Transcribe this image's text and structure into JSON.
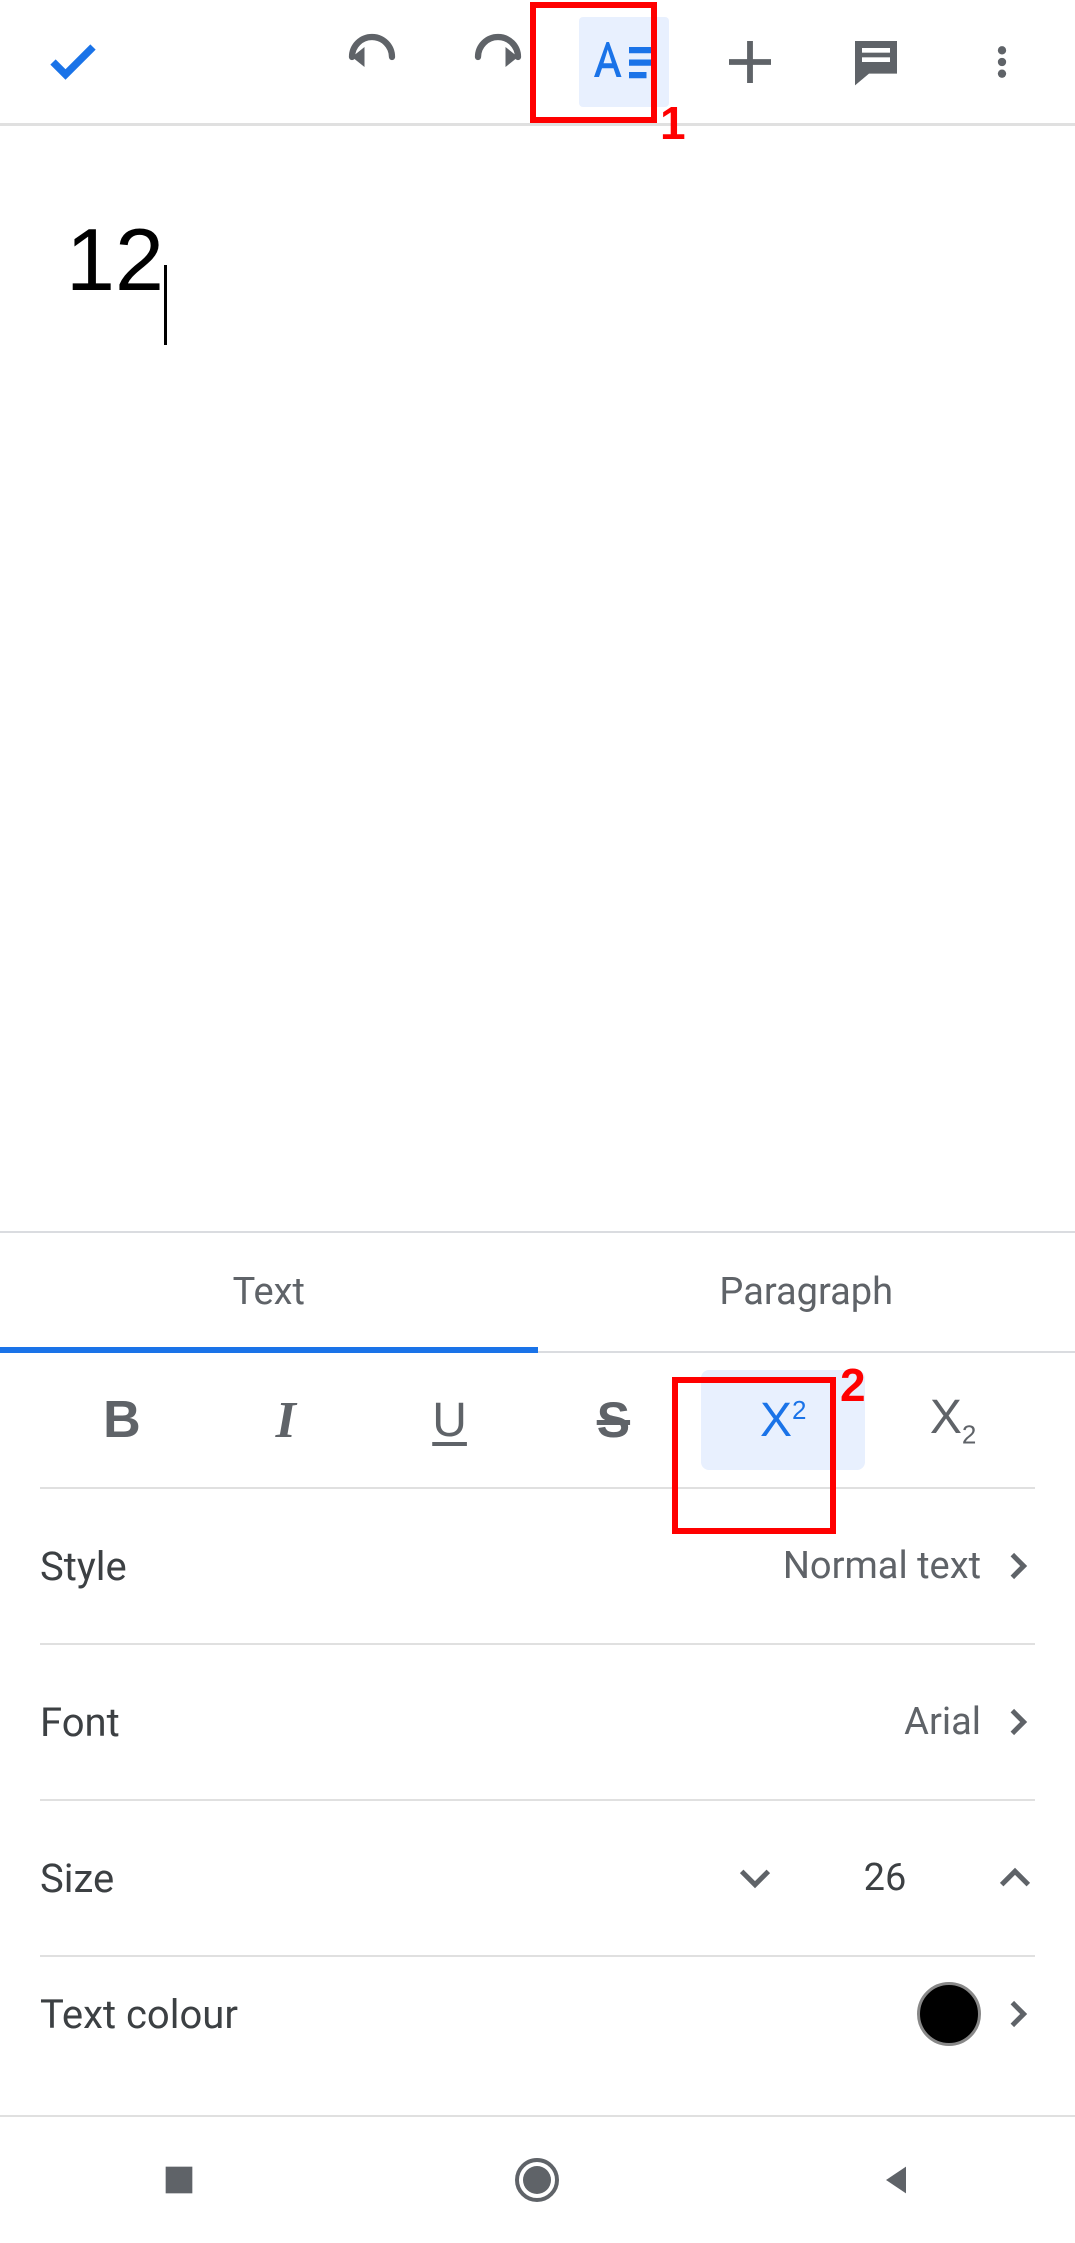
{
  "toolbar": {
    "done": "done",
    "undo": "undo",
    "redo": "redo",
    "format": "format",
    "insert": "insert",
    "comment": "comment",
    "more": "more"
  },
  "document": {
    "text": "12"
  },
  "tabs": {
    "text": "Text",
    "paragraph": "Paragraph"
  },
  "formats": {
    "bold": "B",
    "italic": "I",
    "underline": "U",
    "strike": "S",
    "superscript": "X2",
    "subscript": "X2"
  },
  "rows": {
    "style_label": "Style",
    "style_value": "Normal text",
    "font_label": "Font",
    "font_value": "Arial",
    "size_label": "Size",
    "size_value": "26",
    "text_colour_label": "Text colour"
  },
  "annotations": {
    "one": "1",
    "two": "2"
  }
}
